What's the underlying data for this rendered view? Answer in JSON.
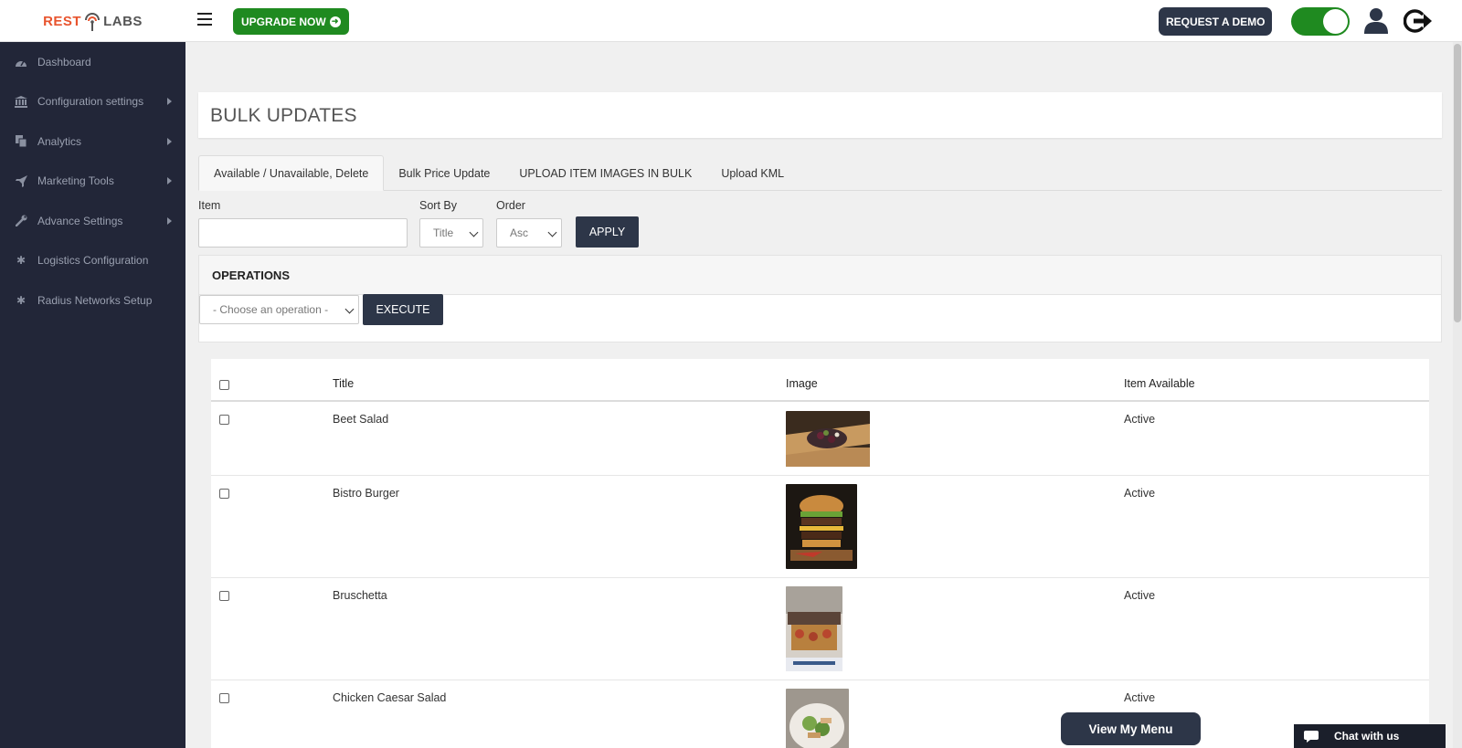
{
  "header": {
    "logo_left": "REST",
    "logo_right": "LABS",
    "upgrade_label": "UPGRADE NOW",
    "demo_label": "REQUEST A DEMO",
    "toggle_on": true
  },
  "sidebar": {
    "items": [
      {
        "label": "Dashboard",
        "icon": "dashboard-icon",
        "submenu": false
      },
      {
        "label": "Configuration settings",
        "icon": "bank-icon",
        "submenu": true
      },
      {
        "label": "Analytics",
        "icon": "copy-icon",
        "submenu": true
      },
      {
        "label": "Marketing Tools",
        "icon": "rocket-icon",
        "submenu": true
      },
      {
        "label": "Advance Settings",
        "icon": "wrench-icon",
        "submenu": true
      },
      {
        "label": "Logistics Configuration",
        "icon": "gear-icon",
        "submenu": false
      },
      {
        "label": "Radius Networks Setup",
        "icon": "gear-icon",
        "submenu": false
      }
    ]
  },
  "main": {
    "title": "BULK UPDATES",
    "tabs": [
      {
        "label": "Available / Unavailable, Delete",
        "active": true
      },
      {
        "label": "Bulk Price Update",
        "active": false
      },
      {
        "label": "UPLOAD ITEM IMAGES IN BULK",
        "active": false
      },
      {
        "label": "Upload KML",
        "active": false
      }
    ],
    "filters": {
      "item_label": "Item",
      "item_value": "",
      "sort_label": "Sort By",
      "sort_value": "Title",
      "order_label": "Order",
      "order_value": "Asc",
      "apply_label": "APPLY"
    },
    "operations": {
      "heading": "OPERATIONS",
      "select_value": "- Choose an operation -",
      "execute_label": "EXECUTE"
    },
    "table": {
      "columns": [
        "Title",
        "Image",
        "Item Available"
      ],
      "rows": [
        {
          "title": "Beet Salad",
          "status": "Active",
          "image": "beet-salad-photo"
        },
        {
          "title": "Bistro Burger",
          "status": "Active",
          "image": "bistro-burger-photo"
        },
        {
          "title": "Bruschetta",
          "status": "Active",
          "image": "bruschetta-photo"
        },
        {
          "title": "Chicken Caesar Salad",
          "status": "Active",
          "image": "chicken-caesar-salad-photo"
        }
      ]
    }
  },
  "floating": {
    "view_menu_label": "View My Menu",
    "chat_label": "Chat with us"
  },
  "colors": {
    "sidebar_bg": "#222638",
    "brand_green": "#1f8a20",
    "dark_button": "#2d3648",
    "logo_orange": "#e8542e"
  }
}
